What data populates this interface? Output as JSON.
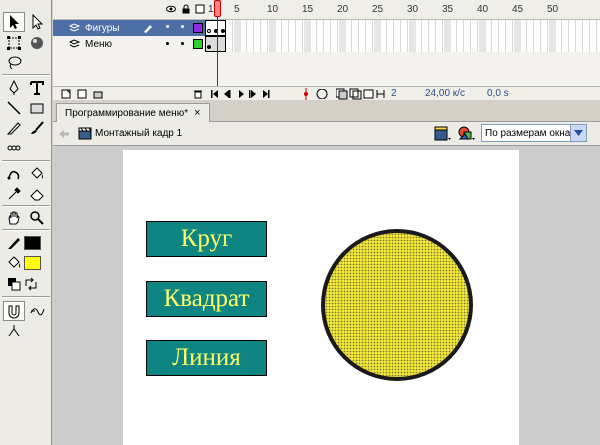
{
  "timeline": {
    "frame_numbers": [
      "5",
      "10",
      "15",
      "20",
      "25",
      "30",
      "35",
      "40",
      "45",
      "50"
    ],
    "first_frame_num": "1",
    "layers": [
      {
        "name": "Фигуры",
        "selected": true,
        "color": "#8a2be2"
      },
      {
        "name": "Меню",
        "selected": false,
        "color": "#33cc33"
      }
    ],
    "current_frame": "2",
    "fps": "24,00 к/с",
    "elapsed": "0,0 s"
  },
  "document": {
    "tab_title": "Программирование меню*",
    "tab_close": "×",
    "scene_label": "Монтажный кадр 1",
    "zoom_value": "По размерам окна"
  },
  "stage": {
    "buttons": [
      {
        "label": "Круг"
      },
      {
        "label": "Квадрат"
      },
      {
        "label": "Линия"
      }
    ]
  },
  "colors": {
    "button_fill": "#0f8583",
    "button_text": "#ffff66",
    "circle_fill": "#f2e63a",
    "stroke_color": "#000000",
    "fill_color": "#ffff00",
    "selection": "#4e6ea6"
  },
  "tools_panel": {
    "icons": [
      "selection-arrow-icon",
      "subselection-arrow-icon",
      "free-transform-icon",
      "fill-transform-icon",
      "lasso-icon",
      "pen-icon",
      "text-icon",
      "line-icon",
      "rectangle-icon",
      "pencil-icon",
      "brush-icon",
      "ink-bottle-icon",
      "paint-bucket-icon",
      "eyedropper-icon",
      "eraser-icon",
      "hand-icon",
      "zoom-icon",
      "snap-icon",
      "smooth-icon",
      "straighten-icon"
    ]
  }
}
